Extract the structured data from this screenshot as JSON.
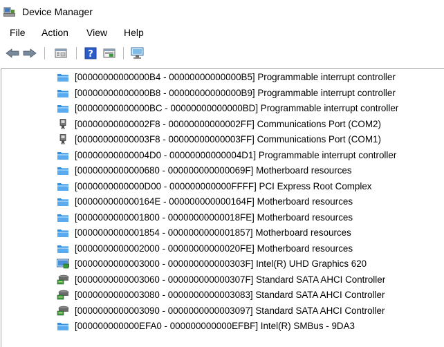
{
  "window": {
    "title": "Device Manager"
  },
  "menu": {
    "items": [
      "File",
      "Action",
      "View",
      "Help"
    ]
  },
  "toolbar": {
    "buttons": [
      "back-arrow-icon",
      "forward-arrow-icon",
      "properties-icon",
      "help-icon",
      "update-driver-icon",
      "monitor-scan-icon"
    ]
  },
  "tree": {
    "rows": [
      {
        "icon": "system-device-icon",
        "text": "[00000000000000B4 - 00000000000000B5]  Programmable interrupt controller"
      },
      {
        "icon": "system-device-icon",
        "text": "[00000000000000B8 - 00000000000000B9]  Programmable interrupt controller"
      },
      {
        "icon": "system-device-icon",
        "text": "[00000000000000BC - 00000000000000BD]  Programmable interrupt controller"
      },
      {
        "icon": "serial-port-icon",
        "text": "[00000000000002F8 - 00000000000002FF]  Communications Port (COM2)"
      },
      {
        "icon": "serial-port-icon",
        "text": "[00000000000003F8 - 00000000000003FF]  Communications Port (COM1)"
      },
      {
        "icon": "system-device-icon",
        "text": "[00000000000004D0 - 00000000000004D1]  Programmable interrupt controller"
      },
      {
        "icon": "system-device-icon",
        "text": "[0000000000000680 - 000000000000069F]  Motherboard resources"
      },
      {
        "icon": "system-device-icon",
        "text": "[0000000000000D00 - 000000000000FFFF]  PCI Express Root Complex"
      },
      {
        "icon": "system-device-icon",
        "text": "[000000000000164E - 000000000000164F]  Motherboard resources"
      },
      {
        "icon": "system-device-icon",
        "text": "[0000000000001800 - 00000000000018FE]  Motherboard resources"
      },
      {
        "icon": "system-device-icon",
        "text": "[0000000000001854 - 0000000000001857]  Motherboard resources"
      },
      {
        "icon": "system-device-icon",
        "text": "[0000000000002000 - 00000000000020FE]  Motherboard resources"
      },
      {
        "icon": "display-adapter-icon",
        "text": "[0000000000003000 - 000000000000303F]  Intel(R) UHD Graphics 620"
      },
      {
        "icon": "storage-controller-icon",
        "text": "[0000000000003060 - 000000000000307F]  Standard SATA AHCI Controller"
      },
      {
        "icon": "storage-controller-icon",
        "text": "[0000000000003080 - 0000000000003083]  Standard SATA AHCI Controller"
      },
      {
        "icon": "storage-controller-icon",
        "text": "[0000000000003090 - 0000000000003097]  Standard SATA AHCI Controller"
      },
      {
        "icon": "system-device-icon",
        "text": "[000000000000EFA0 - 000000000000EFBF]  Intel(R) SMBus - 9DA3"
      }
    ]
  },
  "colors": {
    "folder_blue": "#2f8fe0",
    "folder_light": "#7fc4f5",
    "help_blue": "#2a5dc8"
  }
}
